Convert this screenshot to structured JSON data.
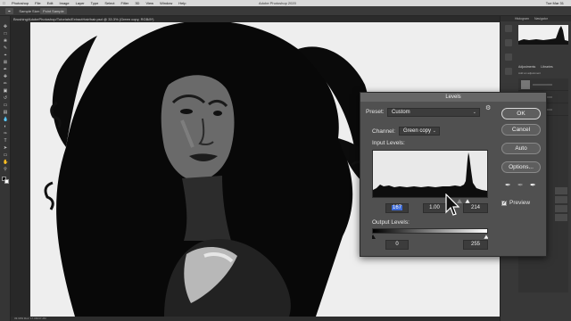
{
  "menubar": {
    "items": [
      "Photoshop",
      "File",
      "Edit",
      "Image",
      "Layer",
      "Type",
      "Select",
      "Filter",
      "3D",
      "View",
      "Window",
      "Help"
    ],
    "window_title": "Adobe Photoshop 2020",
    "clock": "Tue Mar 31"
  },
  "options_bar": {
    "items": [
      "Sample Size:",
      "Point Sample"
    ]
  },
  "document_tab": {
    "label": "Brushing/AdobePhotoshop/Tutorials/ExtractHair/hair.psd @ 33.3% (Green copy, RGB/8*)"
  },
  "status_bar": {
    "text": "33.33%   Doc: 17.0M/47.2M"
  },
  "right_panel": {
    "tabs": [
      "Histogram",
      "Navigator"
    ],
    "adjustments_label": "Adjustments",
    "libraries_label": "Libraries",
    "add_label": "Add an adjustment"
  },
  "levels_dialog": {
    "title": "Levels",
    "preset_label": "Preset:",
    "preset_value": "Custom",
    "channel_label": "Channel:",
    "channel_value": "Green copy",
    "input_levels_label": "Input Levels:",
    "input_black": "167",
    "input_gamma": "1.00",
    "input_white": "214",
    "output_levels_label": "Output Levels:",
    "output_black": "0",
    "output_white": "255",
    "buttons": {
      "ok": "OK",
      "cancel": "Cancel",
      "auto": "Auto",
      "options": "Options..."
    },
    "preview_label": "Preview",
    "preview_checked": true
  },
  "colors": {
    "dialog_bg": "#505050",
    "selection": "#3d6ad6",
    "app_bg": "#1e1e1e"
  }
}
